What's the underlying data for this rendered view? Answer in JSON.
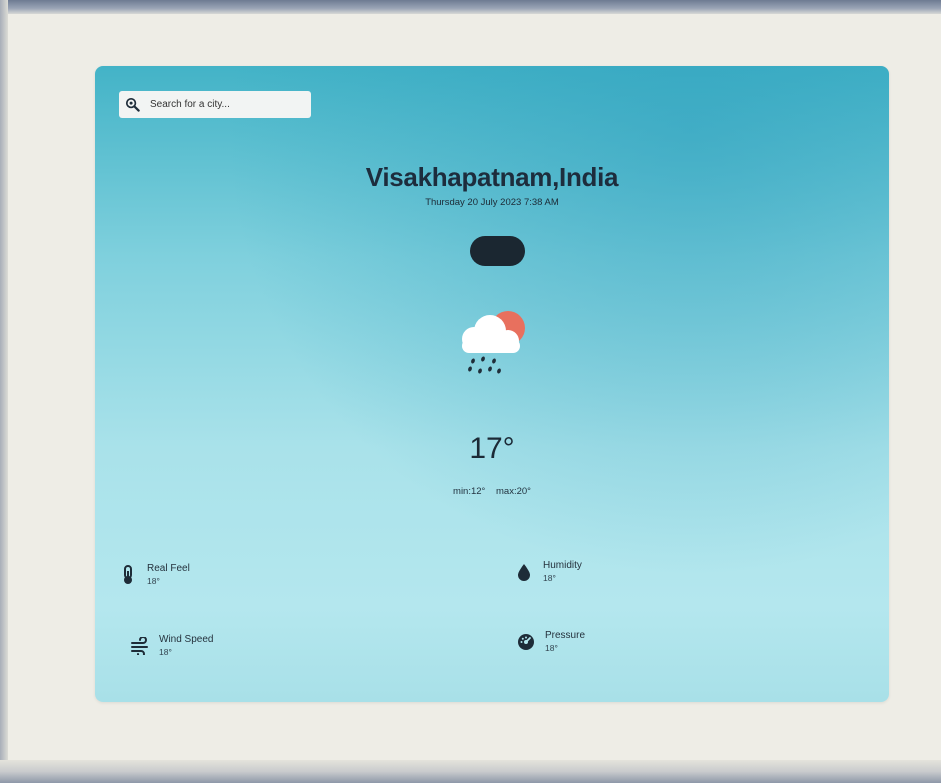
{
  "search": {
    "placeholder": "Search for a city..."
  },
  "location": {
    "city": "Visakhapatnam,India",
    "datetime": "Thursday 20 July 2023 7:38 AM"
  },
  "weather": {
    "icon": "cloud-sun-rain-icon",
    "temperature": "17°",
    "min": "min:12°",
    "max": "max:20°"
  },
  "stats": {
    "real_feel": {
      "label": "Real Feel",
      "value": "18°",
      "icon": "thermometer-icon"
    },
    "humidity": {
      "label": "Humidity",
      "value": "18°",
      "icon": "water-drop-icon"
    },
    "wind_speed": {
      "label": "Wind Speed",
      "value": "18°",
      "icon": "wind-icon"
    },
    "pressure": {
      "label": "Pressure",
      "value": "18°",
      "icon": "gauge-icon"
    }
  },
  "colors": {
    "card_top": "#43b3c7",
    "card_bottom": "#b4e7ee",
    "text_dark": "#1d2d3d",
    "sun": "#e8705e"
  }
}
